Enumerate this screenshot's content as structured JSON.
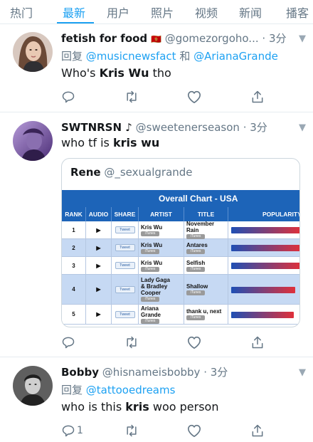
{
  "tabs": [
    "热门",
    "最新",
    "用户",
    "照片",
    "视频",
    "新闻",
    "播客"
  ],
  "active_tab": "最新",
  "colors": {
    "accent": "#1da1f2",
    "chart_header": "#1d64b8",
    "row_alt": "#c6d9f3",
    "bar_start": "#1f4fb4",
    "bar_end": "#e0303a"
  },
  "tweets": [
    {
      "name": "fetish for food",
      "flag": "🇲🇪",
      "handle": "@gomezorgoho...",
      "dot": "·",
      "time": "3分",
      "reply_prefix": "回复",
      "reply_to_1": "@musicnewsfact",
      "reply_and": "和",
      "reply_to_2": "@ArianaGrande",
      "text_before": "Who's ",
      "text_highlight": "Kris Wu",
      "text_after": " tho",
      "reply_count": ""
    },
    {
      "name": "SWTNRSN ♪",
      "handle": "@sweetenerseason",
      "dot": "·",
      "time": "3分",
      "text_before": "who tf is ",
      "text_highlight": "kris wu",
      "text_after": "",
      "quote": {
        "name": "Rene",
        "handle": "@_sexualgrande",
        "chart": {
          "title": "Overall Chart - USA",
          "columns": [
            "RANK",
            "AUDIO",
            "SHARE",
            "ARTIST",
            "TITLE",
            "POPULARITY"
          ],
          "tweet_label": "Tweet",
          "itunes_label": "iTunes",
          "rows": [
            {
              "rank": "1",
              "artist": "Kris Wu",
              "title": "November Rain",
              "popularity": 0.98
            },
            {
              "rank": "2",
              "artist": "Kris Wu",
              "title": "Antares",
              "popularity": 0.98
            },
            {
              "rank": "3",
              "artist": "Kris Wu",
              "title": "Selfish",
              "popularity": 0.98
            },
            {
              "rank": "4",
              "artist": "Lady Gaga & Bradley Cooper",
              "title": "Shallow",
              "popularity": 0.9
            },
            {
              "rank": "5",
              "artist": "Ariana Grande",
              "title": "thank u, next",
              "popularity": 0.88
            }
          ]
        }
      }
    },
    {
      "name": "Bobby",
      "handle": "@hisnameisbobby",
      "dot": "·",
      "time": "3分",
      "reply_prefix": "回复",
      "reply_to_1": "@tattooedreams",
      "text_before": "who is this ",
      "text_highlight": "kris",
      "text_after": " woo person",
      "reply_count": "1"
    }
  ],
  "icons": [
    "reply-icon",
    "retweet-icon",
    "like-icon",
    "share-icon",
    "caret-down-icon"
  ]
}
